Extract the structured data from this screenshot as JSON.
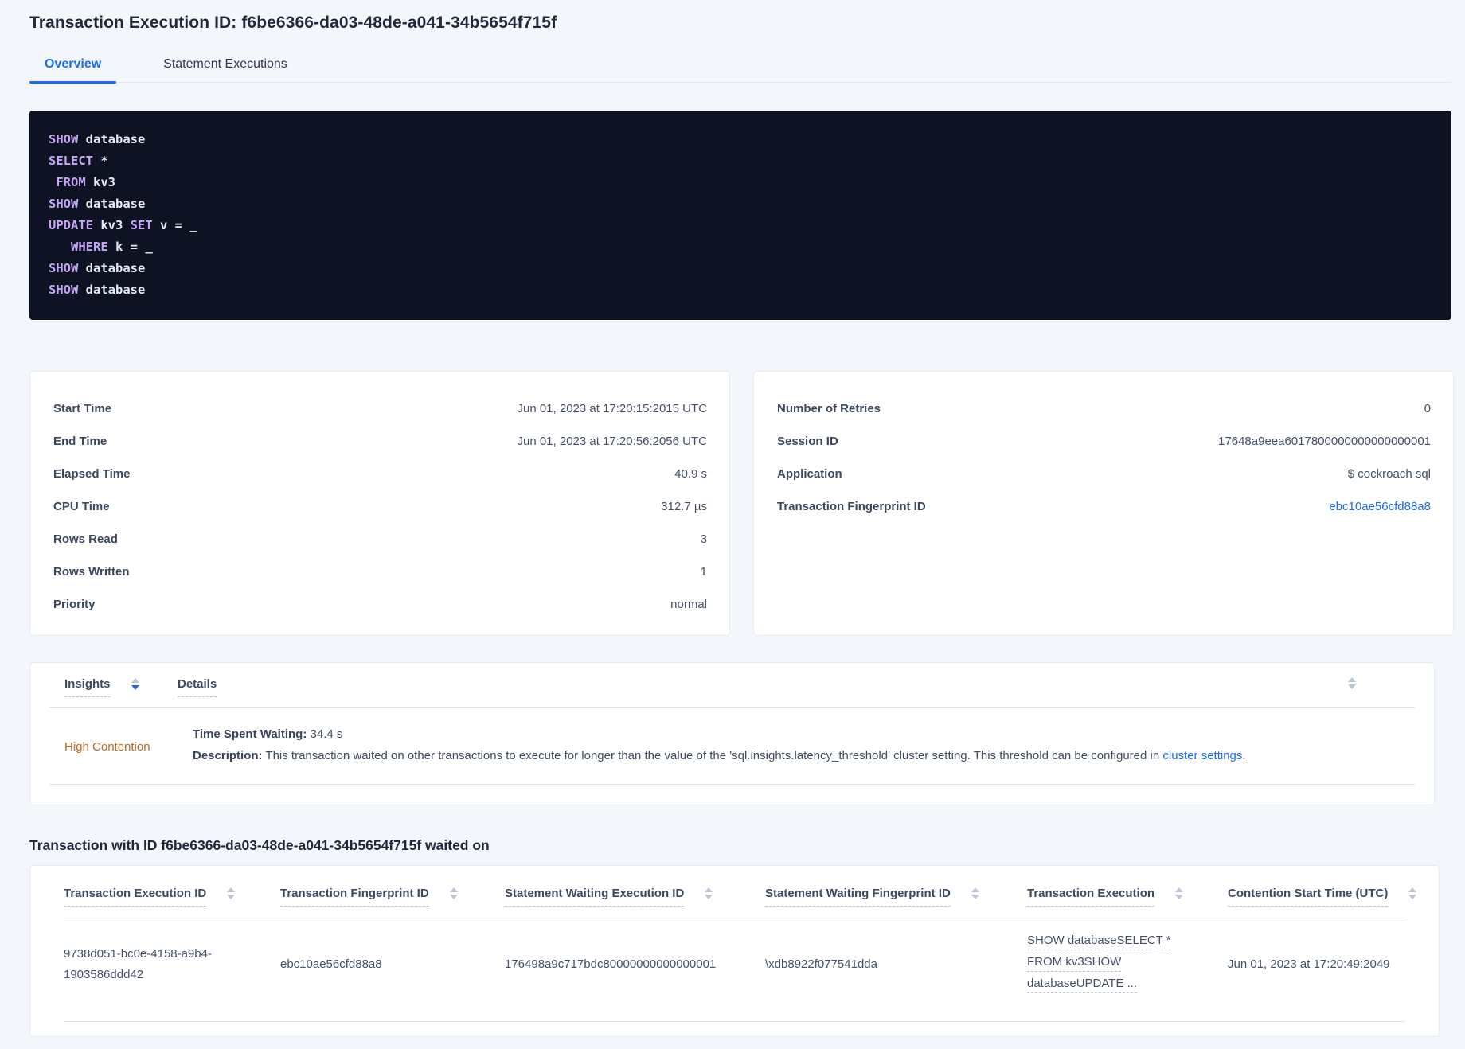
{
  "page": {
    "title": "Transaction Execution ID: f6be6366-da03-48de-a041-34b5654f715f"
  },
  "tabs": [
    {
      "label": "Overview"
    },
    {
      "label": "Statement Executions"
    }
  ],
  "colors": {
    "accent_blue": "#1a6bf5",
    "contention_orange": "#c26a1f",
    "code_background": "#0d1323",
    "code_keyword": "#c7a5f5",
    "code_text": "#e8e9f3"
  },
  "sql_box": {
    "lines": [
      [
        {
          "t": "kw",
          "s": "SHOW"
        },
        {
          "t": "pl",
          "s": " database"
        }
      ],
      [
        {
          "t": "kw",
          "s": "SELECT"
        },
        {
          "t": "pl",
          "s": " *"
        }
      ],
      [
        {
          "t": "pl",
          "s": " "
        },
        {
          "t": "kw",
          "s": "FROM"
        },
        {
          "t": "pl",
          "s": " kv3"
        }
      ],
      [
        {
          "t": "kw",
          "s": "SHOW"
        },
        {
          "t": "pl",
          "s": " database"
        }
      ],
      [
        {
          "t": "kw",
          "s": "UPDATE"
        },
        {
          "t": "pl",
          "s": " kv3 "
        },
        {
          "t": "kw",
          "s": "SET"
        },
        {
          "t": "pl",
          "s": " v = _"
        }
      ],
      [
        {
          "t": "pl",
          "s": "   "
        },
        {
          "t": "kw",
          "s": "WHERE"
        },
        {
          "t": "pl",
          "s": " k = _"
        }
      ],
      [
        {
          "t": "kw",
          "s": "SHOW"
        },
        {
          "t": "pl",
          "s": " database"
        }
      ],
      [
        {
          "t": "kw",
          "s": "SHOW"
        },
        {
          "t": "pl",
          "s": " database"
        }
      ]
    ]
  },
  "summary_left": {
    "rows": [
      {
        "label": "Start Time",
        "value": "Jun 01, 2023 at 17:20:15:2015 UTC"
      },
      {
        "label": "End Time",
        "value": "Jun 01, 2023 at 17:20:56:2056 UTC"
      },
      {
        "label": "Elapsed Time",
        "value": "40.9 s"
      },
      {
        "label": "CPU Time",
        "value": "312.7 µs"
      },
      {
        "label": "Rows Read",
        "value": "3"
      },
      {
        "label": "Rows Written",
        "value": "1"
      },
      {
        "label": "Priority",
        "value": "normal"
      }
    ]
  },
  "summary_right": {
    "rows": [
      {
        "label": "Number of Retries",
        "value": "0"
      },
      {
        "label": "Session ID",
        "value": "17648a9eea6017800000000000000001"
      },
      {
        "label": "Application",
        "value": "$ cockroach sql"
      },
      {
        "label": "Transaction Fingerprint ID",
        "value": "ebc10ae56cfd88a8"
      }
    ]
  },
  "insights": {
    "col_insights": "Insights",
    "col_details": "Details",
    "row": {
      "insight": "High Contention",
      "waiting_label": "Time Spent Waiting:",
      "waiting_value": " 34.4 s",
      "desc_label": "Description:",
      "desc_text": " This transaction waited on other transactions to execute for longer than the value of the 'sql.insights.latency_threshold' cluster setting. This threshold can be configured in ",
      "desc_link": "cluster settings",
      "desc_suffix": "."
    }
  },
  "waited_on": {
    "heading": "Transaction with ID f6be6366-da03-48de-a041-34b5654f715f waited on",
    "columns": [
      "Transaction Execution ID",
      "Transaction Fingerprint ID",
      "Statement Waiting Execution ID",
      "Statement Waiting Fingerprint ID",
      "Transaction Execution",
      "Contention Start Time (UTC)"
    ],
    "row": {
      "txn_execution_id": "9738d051-bc0e-4158-a9b4-1903586ddd42",
      "txn_fingerprint_id": "ebc10ae56cfd88a8",
      "stmt_waiting_execution_id": "176498a9c717bdc80000000000000001",
      "stmt_waiting_fingerprint_id": "\\xdb8922f077541dda",
      "txn_execution_lines": [
        "SHOW databaseSELECT *",
        "FROM kv3SHOW",
        "databaseUPDATE ..."
      ],
      "contention_start": "Jun 01, 2023 at 17:20:49:2049"
    }
  }
}
